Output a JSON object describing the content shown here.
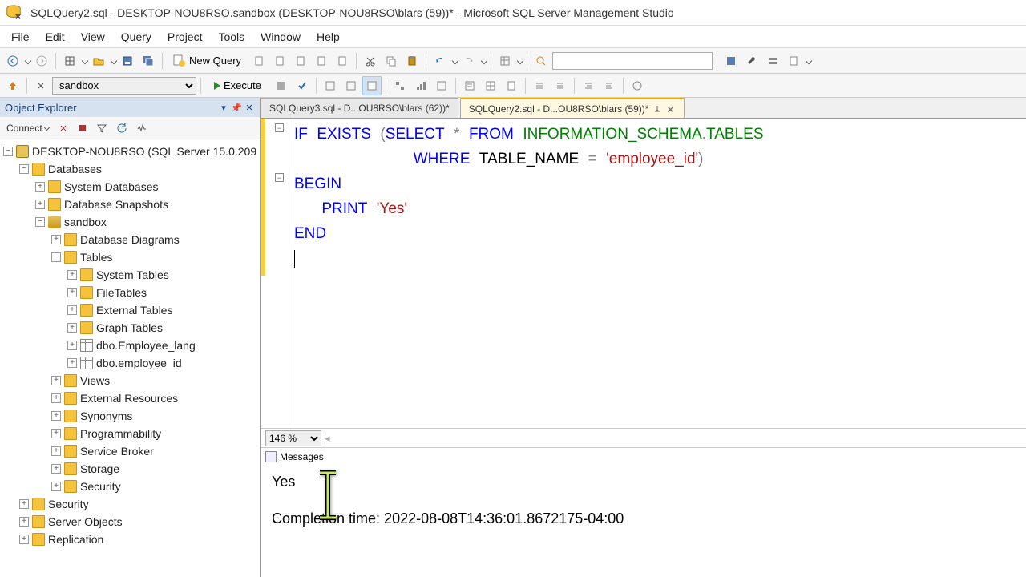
{
  "window": {
    "title": "SQLQuery2.sql - DESKTOP-NOU8RSO.sandbox (DESKTOP-NOU8RSO\\blars (59))* - Microsoft SQL Server Management Studio"
  },
  "menubar": [
    "File",
    "Edit",
    "View",
    "Query",
    "Project",
    "Tools",
    "Window",
    "Help"
  ],
  "toolbar": {
    "new_query": "New Query"
  },
  "toolbar2": {
    "db": "sandbox",
    "execute": "Execute"
  },
  "explorer": {
    "title": "Object Explorer",
    "connect": "Connect",
    "server": "DESKTOP-NOU8RSO (SQL Server 15.0.209",
    "nodes": {
      "databases": "Databases",
      "sys_db": "System Databases",
      "snapshots": "Database Snapshots",
      "sandbox": "sandbox",
      "diagrams": "Database Diagrams",
      "tables": "Tables",
      "sys_tables": "System Tables",
      "file_tables": "FileTables",
      "ext_tables": "External Tables",
      "graph_tables": "Graph Tables",
      "t1": "dbo.Employee_lang",
      "t2": "dbo.employee_id",
      "views": "Views",
      "ext_res": "External Resources",
      "synonyms": "Synonyms",
      "prog": "Programmability",
      "broker": "Service Broker",
      "storage": "Storage",
      "security": "Security",
      "sec2": "Security",
      "server_obj": "Server Objects",
      "replication": "Replication"
    }
  },
  "tabs": [
    {
      "label": "SQLQuery3.sql - D...OU8RSO\\blars (62))*"
    },
    {
      "label": "SQLQuery2.sql - D...OU8RSO\\blars (59))*"
    }
  ],
  "code": {
    "line1a": "IF",
    "line1b": "EXISTS",
    "line1c": "(",
    "line1d": "SELECT",
    "line1e": "*",
    "line1f": "FROM",
    "line1g": "INFORMATION_SCHEMA",
    "line1h": ".",
    "line1i": "TABLES",
    "line2a": "WHERE",
    "line2b": "TABLE_NAME",
    "line2c": "=",
    "line2d": "'employee_id'",
    "line2e": ")",
    "line3": "BEGIN",
    "line4a": "PRINT",
    "line4b": "'Yes'",
    "line5": "END"
  },
  "zoom": "146 %",
  "messages": {
    "tab": "Messages",
    "line1": "Yes",
    "line2": "Completion time: 2022-08-08T14:36:01.8672175-04:00"
  }
}
